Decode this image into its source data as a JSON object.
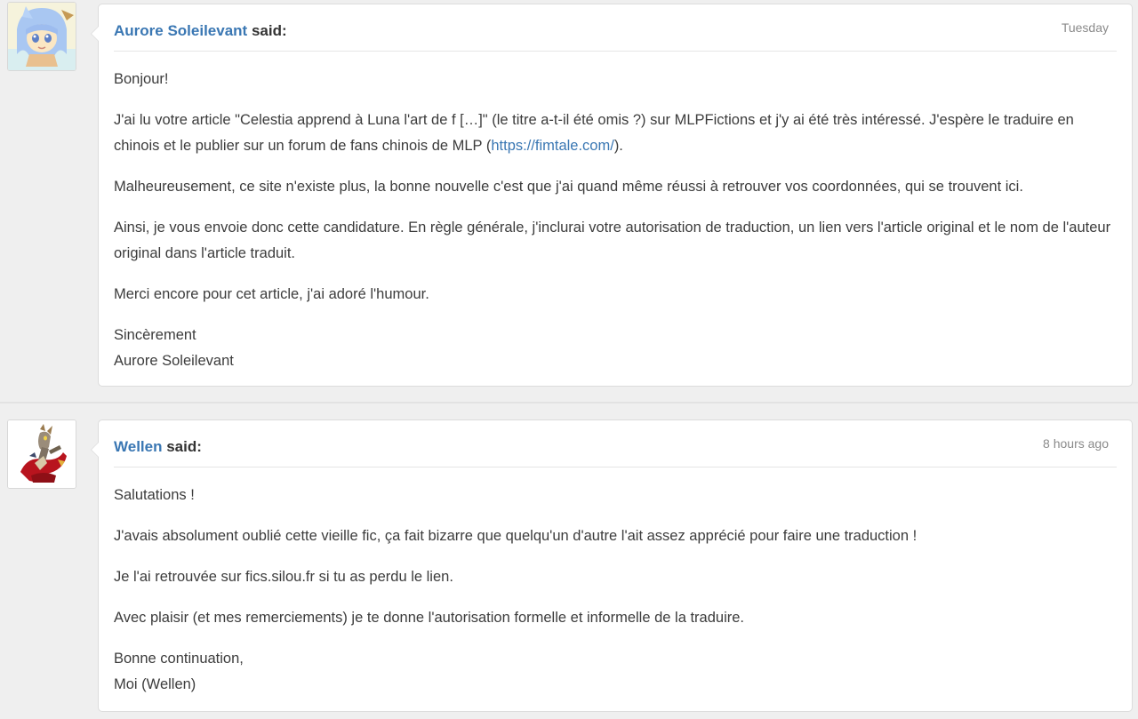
{
  "posts": [
    {
      "author": "Aurore Soleilevant",
      "said": "said:",
      "time": "Tuesday",
      "avatar_icon": "pony-avatar-blue-hair",
      "paragraphs": [
        {
          "lines": [
            "Bonjour!"
          ]
        },
        {
          "before": "J'ai lu votre article \"Celestia apprend à Luna l'art de f […]\" (le titre a-t-il été omis ?) sur MLPFictions et j'y ai été très intéressé. J'espère le traduire en chinois et le publier sur un forum de fans chinois de MLP (",
          "link": "https://fimtale.com/",
          "after": ")."
        },
        {
          "lines": [
            "Malheureusement, ce site n'existe plus, la bonne nouvelle c'est que j'ai quand même réussi à retrouver vos coordonnées, qui se trouvent ici."
          ]
        },
        {
          "lines": [
            "Ainsi, je vous envoie donc cette candidature. En règle générale, j'inclurai votre autorisation de traduction, un lien vers l'article original et le nom de l'auteur original dans l'article traduit."
          ]
        },
        {
          "lines": [
            "Merci encore pour cet article, j'ai adoré l'humour."
          ]
        },
        {
          "lines": [
            "Sincèrement",
            "Aurore Soleilevant"
          ]
        }
      ]
    },
    {
      "author": "Wellen",
      "said": "said:",
      "time": "8 hours ago",
      "avatar_icon": "discord-draconequus-avatar",
      "paragraphs": [
        {
          "lines": [
            "Salutations !"
          ]
        },
        {
          "lines": [
            "J'avais absolument oublié cette vieille fic, ça fait bizarre que quelqu'un d'autre l'ait assez apprécié pour faire une traduction !"
          ]
        },
        {
          "lines": [
            "Je l'ai retrouvée sur fics.silou.fr si tu as perdu le lien."
          ]
        },
        {
          "lines": [
            "Avec plaisir (et mes remerciements) je te donne l'autorisation formelle et informelle de la traduire."
          ]
        },
        {
          "lines": [
            "Bonne continuation,",
            "Moi (Wellen)"
          ]
        }
      ]
    }
  ],
  "colors": {
    "link": "#3a77b3",
    "page_bg": "#efefef",
    "bubble_bg": "#ffffff",
    "text": "#3c3c3c",
    "muted": "#8a8a8a"
  }
}
